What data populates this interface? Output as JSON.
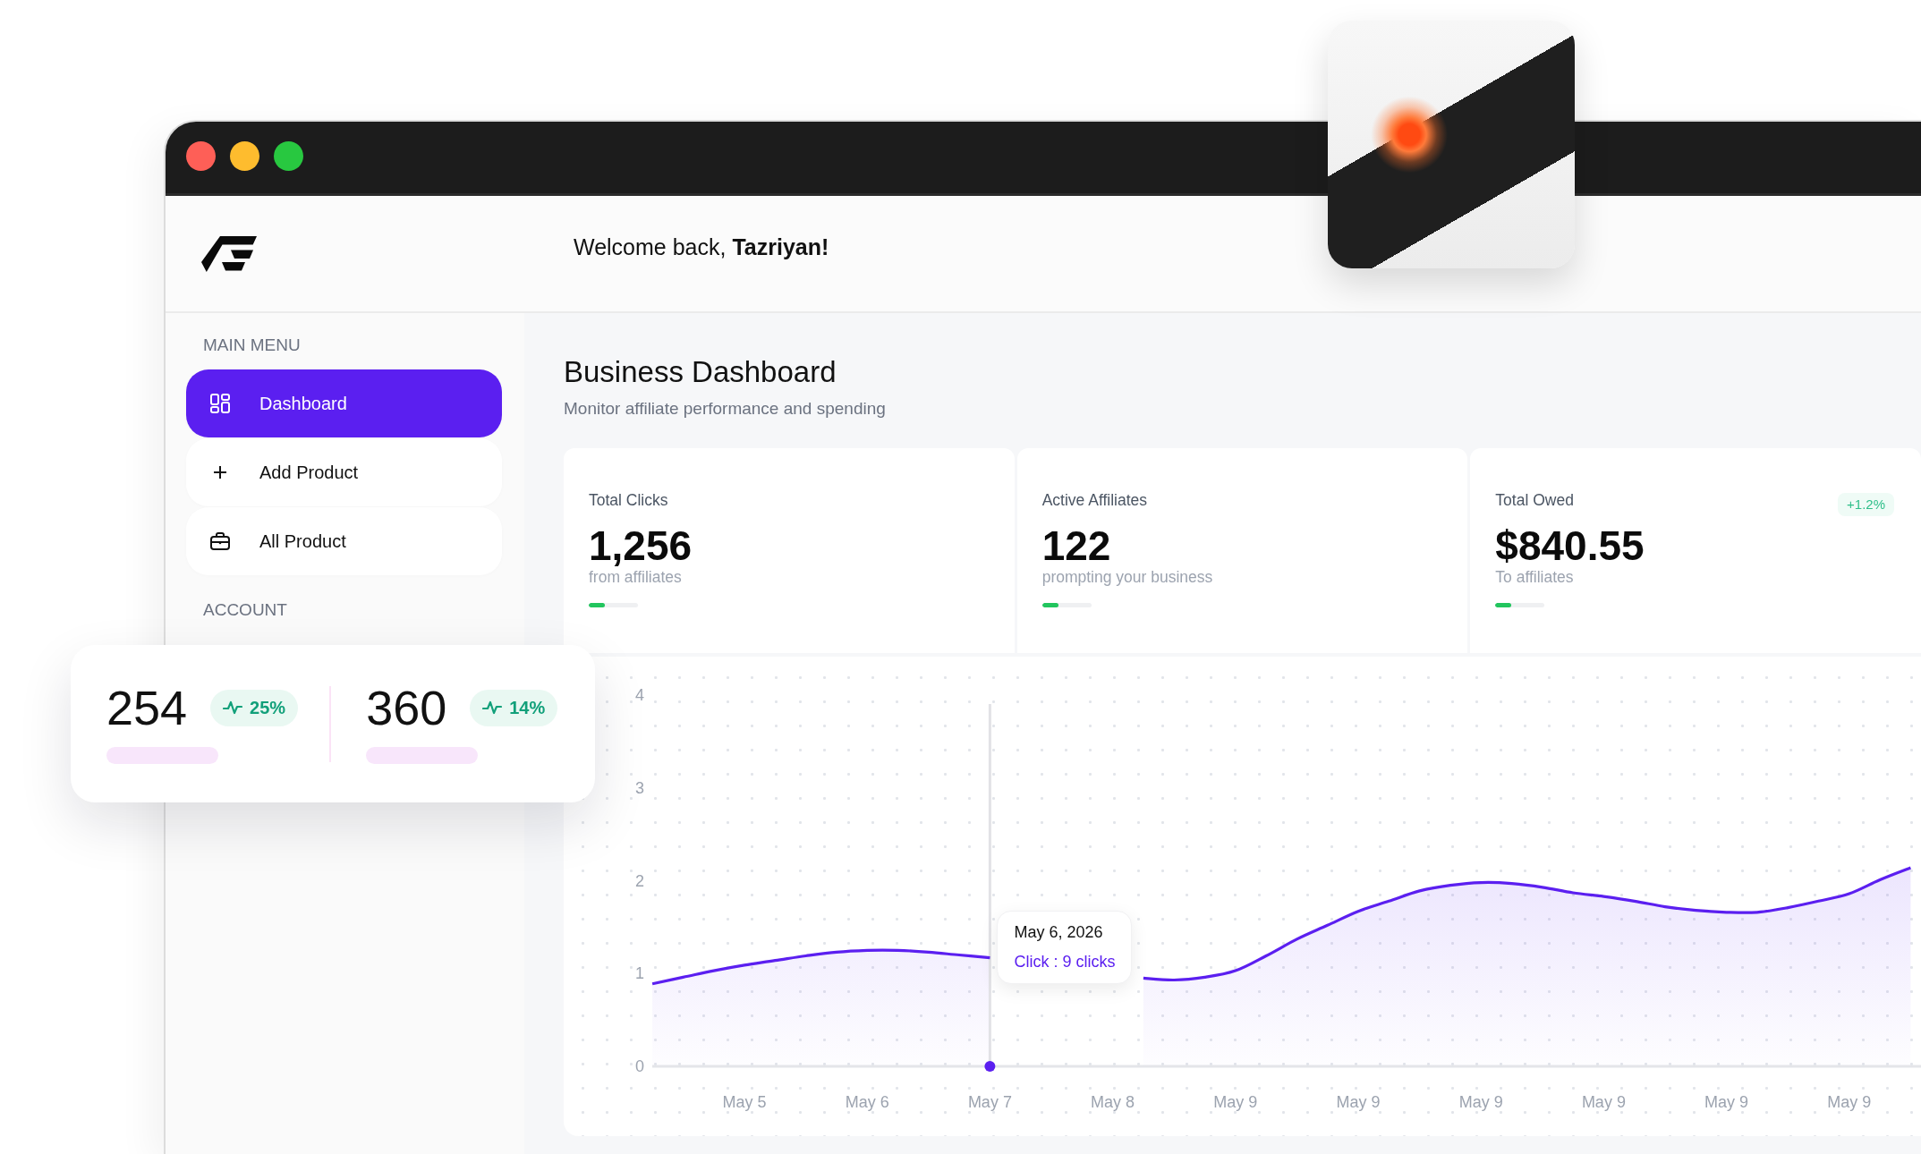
{
  "header": {
    "welcome": "Welcome back, **Tazriyan!**"
  },
  "sidebar": {
    "sections": [
      {
        "title": "MAIN MENU",
        "items": [
          {
            "label": "Dashboard",
            "selected": true
          },
          {
            "label": "Add Product",
            "selected": false
          },
          {
            "label": "All Product",
            "selected": false
          }
        ]
      },
      {
        "title": "ACCOUNT"
      }
    ]
  },
  "page": {
    "title": "Business Dashboard",
    "subtitle": "Monitor affiliate performance and spending"
  },
  "stat_cards": [
    {
      "label": "Total Clicks",
      "value": "1,256",
      "caption": "from affiliates",
      "level": 0.32
    },
    {
      "label": "Active Affiliates",
      "value": "122",
      "caption": "prompting your business",
      "level": 0.33
    },
    {
      "label": "Total Owed",
      "value": "$840.55",
      "caption": "To affiliates",
      "level": 0.33,
      "badge": "+1.2%"
    }
  ],
  "chart": {
    "chart_data": {
      "type": "area",
      "categories": [
        null,
        null,
        null,
        "May 5",
        null,
        null,
        null,
        "May 6",
        null,
        null,
        null,
        "May 7",
        null,
        null,
        null,
        "May 8",
        null,
        null,
        null,
        "May 9",
        null,
        null,
        null,
        "May 9",
        null,
        null,
        null,
        "May 9",
        null,
        null,
        null,
        "May 9",
        null,
        null,
        null,
        "May 9",
        null,
        null,
        null,
        "May 9",
        null,
        null
      ],
      "values": [
        0.89,
        0.96,
        1.03,
        1.09,
        1.14,
        1.19,
        1.23,
        1.25,
        1.25,
        1.23,
        1.2,
        1.17,
        null,
        null,
        null,
        null,
        0.95,
        0.93,
        0.96,
        1.03,
        1.19,
        1.37,
        1.52,
        1.67,
        1.78,
        1.89,
        1.95,
        1.98,
        1.97,
        1.93,
        1.87,
        1.83,
        1.78,
        1.72,
        1.68,
        1.66,
        1.66,
        1.71,
        1.78,
        1.86,
        2.01,
        2.14
      ],
      "ylim": [
        0,
        4
      ],
      "yticks": [
        0,
        1,
        2,
        3,
        4
      ]
    },
    "tooltip": {
      "date": "May 6, 2026",
      "value": "Click : 9 clicks"
    }
  },
  "overlay_stats": [
    {
      "value": "254",
      "change": "25%"
    },
    {
      "value": "360",
      "change": "14%"
    }
  ]
}
